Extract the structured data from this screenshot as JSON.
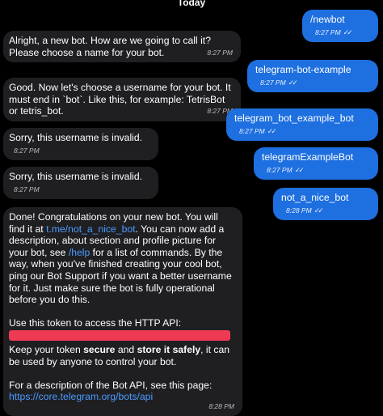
{
  "date_header": "Today",
  "messages": [
    {
      "text": "/newbot",
      "time": "8:27 PM"
    },
    {
      "text": "Alright, a new bot. How are we going to call it? Please choose a name for your bot.",
      "time": "8:27 PM"
    },
    {
      "text": "telegram-bot-example",
      "time": "8:27 PM"
    },
    {
      "text": "Good. Now let's choose a username for your bot. It must end in `bot`. Like this, for example: TetrisBot or tetris_bot.",
      "time": "8:27 PM"
    },
    {
      "text": "telegram_bot_example_bot",
      "time": "8:27 PM"
    },
    {
      "text": "Sorry, this username is invalid.",
      "time": "8:27 PM"
    },
    {
      "text": "telegramExampleBot",
      "time": "8:27 PM"
    },
    {
      "text": "Sorry, this username is invalid.",
      "time": "8:27 PM"
    },
    {
      "text": "not_a_nice_bot",
      "time": "8:28 PM"
    }
  ],
  "final_message": {
    "p1_a": "Done! Congratulations on your new bot. You will find it at ",
    "p1_link": "t.me/not_a_nice_bot",
    "p1_b": ". You can now add a description, about section and profile picture for your bot, see ",
    "p1_cmd": "/help",
    "p1_c": " for a list of commands. By the way, when you've finished creating your cool bot, ping our Bot Support if you want a better username for it. Just make sure the bot is fully operational before you do this.",
    "p2": "Use this token to access the HTTP API:",
    "p3_a": "Keep your token ",
    "p3_b1": "secure",
    "p3_c": " and ",
    "p3_b2": "store it safely",
    "p3_d": ", it can be used by anyone to control your bot.",
    "p4_a": "For a description of the Bot API, see this page: ",
    "p4_link": "https://core.telegram.org/bots/api",
    "time": "8:28 PM"
  },
  "colors": {
    "incoming": "#1f1f22",
    "outgoing": "#1e6fe0",
    "link": "#4b9bff",
    "redaction": "#ee3a52"
  }
}
